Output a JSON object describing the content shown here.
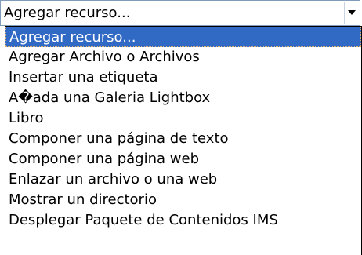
{
  "select": {
    "current_value": "Agregar recurso...",
    "arrow_icon": "chevron-down-icon"
  },
  "dropdown": {
    "options": [
      {
        "label": "Agregar recurso...",
        "selected": true
      },
      {
        "label": "Agregar Archivo o Archivos",
        "selected": false
      },
      {
        "label": "Insertar una etiqueta",
        "selected": false
      },
      {
        "label": "A�ada una Galeria Lightbox",
        "selected": false
      },
      {
        "label": "Libro",
        "selected": false
      },
      {
        "label": "Componer una página de texto",
        "selected": false
      },
      {
        "label": "Componer una página web",
        "selected": false
      },
      {
        "label": "Enlazar un archivo o una web",
        "selected": false
      },
      {
        "label": "Mostrar un directorio",
        "selected": false
      },
      {
        "label": "Desplegar Paquete de Contenidos IMS",
        "selected": false
      }
    ]
  },
  "colors": {
    "selection_background": "#316ac5",
    "selection_text": "#ffffff",
    "select_border": "#7f9db9"
  }
}
